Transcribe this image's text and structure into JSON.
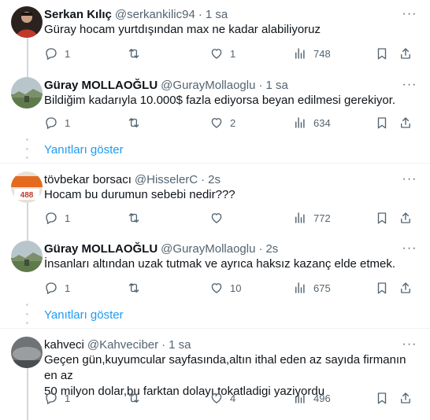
{
  "show_replies_label": "Yanıtları göster",
  "colors": {
    "accent": "#1d9bf0",
    "muted": "#536471",
    "text": "#0f1419",
    "line": "#cfd9de"
  },
  "tweets": [
    {
      "name": "Serkan Kılıç",
      "handle": "@serkankilic94",
      "time": "1 sa",
      "text": "Güray hocam yurtdışından max ne kadar alabiliyoruz",
      "replies": "1",
      "retweets": "",
      "likes": "1",
      "views": "748",
      "avatar_icon": "profile-photo-person-red"
    },
    {
      "name": "Güray MOLLAOĞLU",
      "handle": "@GurayMollaoglu",
      "time": "1 sa",
      "text": "Bildiğim kadarıyla 10.000$ fazla ediyorsa beyan edilmesi gerekiyor.",
      "replies": "1",
      "retweets": "",
      "likes": "2",
      "views": "634",
      "avatar_icon": "profile-photo-landscape"
    },
    {
      "name": "tövbekar borsacı",
      "handle": "@HisselerC",
      "time": "2s",
      "text": "Hocam bu durumun sebebi nedir???",
      "replies": "1",
      "retweets": "",
      "likes": "",
      "views": "772",
      "avatar_icon": "profile-photo-price-sign",
      "avatar_text": "488"
    },
    {
      "name": "Güray MOLLAOĞLU",
      "handle": "@GurayMollaoglu",
      "time": "2s",
      "text": "İnsanları altından uzak tutmak ve ayrıca haksız kazanç elde etmek.",
      "replies": "1",
      "retweets": "",
      "likes": "10",
      "views": "675",
      "avatar_icon": "profile-photo-landscape"
    },
    {
      "name": "kahveci",
      "handle": "@Kahveciber",
      "time": "1 sa",
      "text_lines": [
        "Geçen gün,kuyumcular sayfasında,altın ithal eden az sayıda firmanın en az",
        "50 milyon dolar,bu farktan dolayı,tokatladigi yaziyordu"
      ],
      "replies": "1",
      "retweets": "",
      "likes": "4",
      "views": "496",
      "avatar_icon": "profile-photo-grey"
    }
  ]
}
